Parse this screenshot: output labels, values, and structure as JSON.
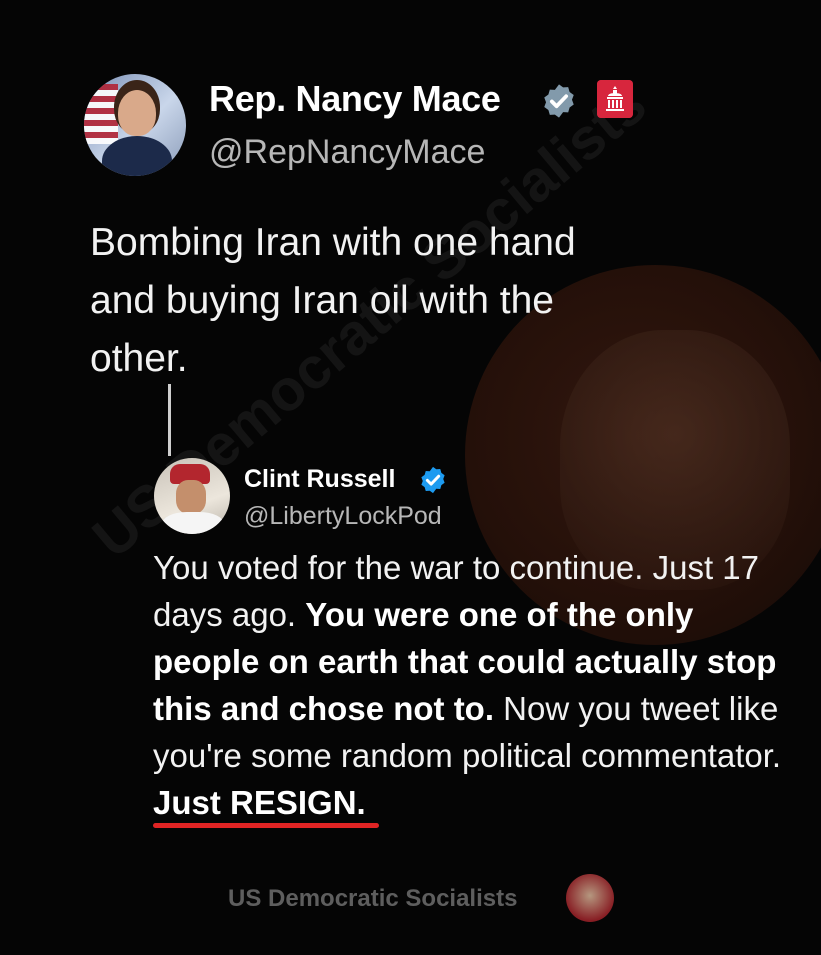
{
  "original_tweet": {
    "display_name": "Rep. Nancy Mace",
    "handle": "@RepNancyMace",
    "text": "Bombing Iran with one hand and buying Iran oil with the other.",
    "avatar": "politician-avatar",
    "verified_icon": "verified-badge-gray",
    "affiliation_icon": "capitol-badge"
  },
  "reply_tweet": {
    "display_name": "Clint Russell",
    "handle": "@LibertyLockPod",
    "text_1": "You voted for the war to continue. Just 17 days ago. ",
    "text_bold": "You were one of the only people on earth that could actually stop this and chose not to.",
    "text_2": " Now you tweet like you're some random political commentator. ",
    "text_resign": "Just RESIGN.",
    "avatar": "user-avatar",
    "verified_icon": "verified-badge-blue"
  },
  "watermark": {
    "diagonal_text": "US Democratic Socialists",
    "footer_text": "US Democratic Socialists",
    "footer_icon": "dsa-logo-icon"
  },
  "colors": {
    "background": "#050505",
    "verified_gray": "#829aab",
    "verified_blue": "#1d9bf0",
    "underline_red": "#e02424",
    "affiliation_red": "#d7263d"
  }
}
